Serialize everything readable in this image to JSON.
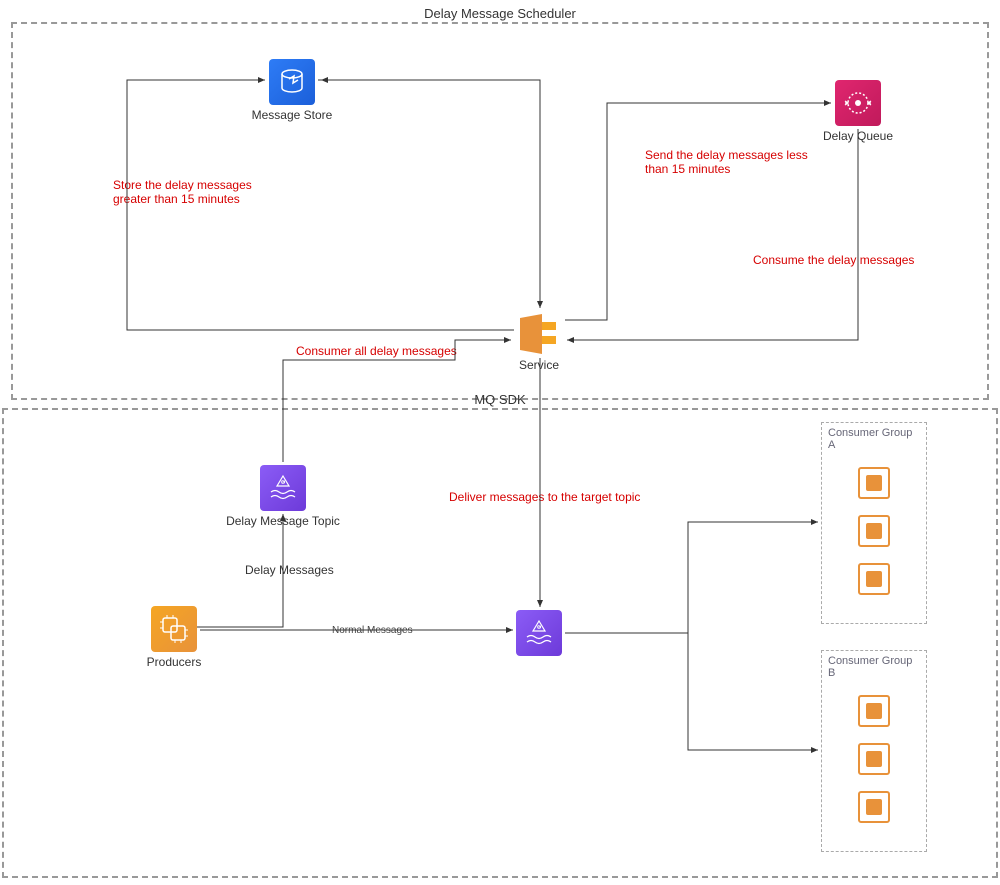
{
  "title_upper": "Delay Message Scheduler",
  "title_lower": "MQ SDK",
  "nodes": {
    "message_store": "Message Store",
    "delay_queue": "Delay Queue",
    "service": "Service",
    "delay_topic": "Delay Message Topic",
    "producers": "Producers",
    "group_a": "Consumer Group A",
    "group_b": "Consumer Group B"
  },
  "edges": {
    "store_gt15": "Store the delay messages greater than 15 minutes",
    "send_lt15": "Send the delay messages less than 15 minutes",
    "consume_dq": "Consume the delay messages",
    "consume_all": "Consumer all delay messages",
    "deliver": "Deliver messages to the target topic",
    "delay_msgs": "Delay Messages",
    "normal_msgs": "Normal Messages"
  },
  "colors": {
    "red": "#d60000",
    "orange": "#e8923a",
    "purple": "#7b4cd8",
    "blue": "#2e7cf6",
    "pink": "#d42a6f"
  }
}
